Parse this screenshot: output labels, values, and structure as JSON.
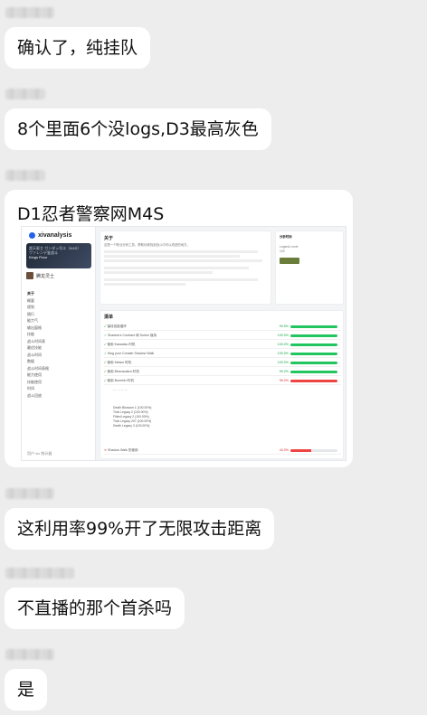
{
  "messages": [
    {
      "id": "m1",
      "text": "确认了，纯挂队"
    },
    {
      "id": "m2",
      "text": "8个里面6个没logs,D3最高灰色"
    },
    {
      "id": "m3",
      "text": "D1忍者警察网M4S"
    },
    {
      "id": "m4",
      "text": "这利用率99%开了无限攻击距离"
    },
    {
      "id": "m5",
      "text": "不直播的那个首杀吗"
    },
    {
      "id": "m6",
      "text": "是"
    }
  ],
  "shot": {
    "site": "xivanalysis",
    "banner_line1": "超天驱主 ガンダッ号エ（M4S）",
    "banner_line2": "ヴァレンデ鉴战斗",
    "banner_line3": "Kings Floor",
    "character": "腾龙灵士",
    "nav": [
      "关于",
      "概要",
      "规划",
      "随行",
      "能力气",
      "输出窗格",
      "技能",
      "战斗时间表",
      "最优技能",
      "战斗时间",
      "数据",
      "战斗时间表格",
      "能力使用",
      "技能使用",
      "时间",
      "战斗回放"
    ],
    "footer": "用户·xiv 统计器",
    "about_title": "关于",
    "about_text": "这是一个职业分析工具，帮助玩家找到战斗中可以改进的地方。",
    "info_label": "分析时间",
    "legend_label": "Legend Level",
    "legend_value": "100",
    "checklist_title": "清单",
    "rows": [
      {
        "label": "保持技能循环",
        "pct": "99.5%",
        "fill": 99.5,
        "color": "#22c55e"
      },
      {
        "label": "Shadow's Contract 和 Suiton 保持",
        "pct": "100.0%",
        "fill": 100,
        "color": "#22c55e"
      },
      {
        "label": "使用 Kassatsu 时机",
        "pct": "100.0%",
        "fill": 100,
        "color": "#22c55e"
      },
      {
        "label": "Mug your Contain Shadow Walk",
        "pct": "100.0%",
        "fill": 100,
        "color": "#22c55e"
      },
      {
        "label": "使用 Meisui 时机",
        "pct": "100.0%",
        "fill": 100,
        "color": "#22c55e"
      },
      {
        "label": "使用 Bhavacakra 时机",
        "pct": "99.2%",
        "fill": 99.2,
        "color": "#22c55e"
      },
      {
        "label": "使用 Bunshin 时机",
        "pct": "99.2%",
        "fill": 99.2,
        "color": "#ef4444"
      }
    ],
    "last_row": {
      "label": "Shadow Walk 的使用",
      "pct": "44.3%",
      "fill": 44.3,
      "color": "#ef4444"
    },
    "sub_lines": [
      "Death Blossom 1 (100.00%)",
      "Trick Legacy 2 (100.00%)",
      "Fitted Legacy 2 (100.00%)",
      "Trick Legacy 207 (100.00%)",
      "Death Legacy 3 (100.00%)"
    ]
  }
}
